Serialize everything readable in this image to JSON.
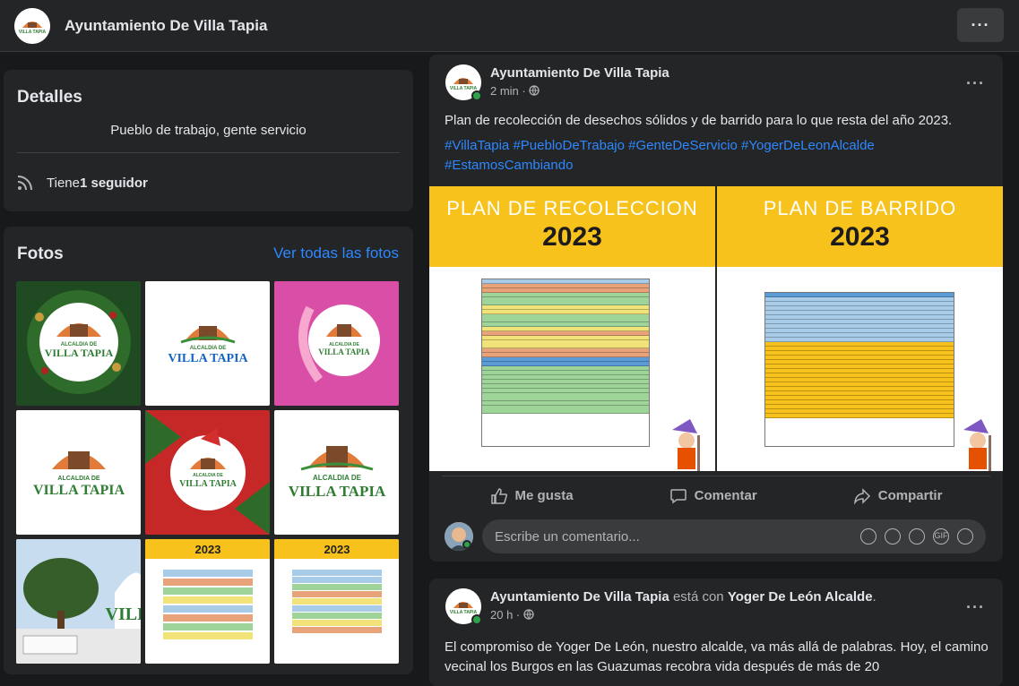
{
  "page": {
    "title": "Ayuntamiento De Villa Tapia",
    "more_label": "···"
  },
  "details": {
    "heading": "Detalles",
    "description": "Pueblo de trabajo, gente servicio",
    "followers_prefix": "Tiene ",
    "followers_count": "1 seguidor"
  },
  "photos": {
    "heading": "Fotos",
    "see_all": "Ver todas las fotos",
    "thumbs": [
      {
        "logo_small": "ALCALDIA DE",
        "logo_big": "VILLA TAPIA",
        "theme": "christmas-wreath"
      },
      {
        "logo_small": "ALCALDIA DE",
        "logo_big": "VILLA TAPIA",
        "theme": "white"
      },
      {
        "logo_small": "ALCALDIA DE",
        "logo_big": "VILLA TAPIA",
        "theme": "pink-ribbon"
      },
      {
        "logo_small": "ALCALDIA DE",
        "logo_big": "VILLA TAPIA",
        "theme": "white"
      },
      {
        "logo_small": "ALCALDIA DE",
        "logo_big": "VILLA TAPIA",
        "theme": "christmas-red"
      },
      {
        "logo_small": "ALCALDIA DE",
        "logo_big": "VILLA TAPIA",
        "theme": "white"
      },
      {
        "logo_small": "",
        "logo_big": "VILL",
        "theme": "photo"
      },
      {
        "year": "2023",
        "theme": "plan-recoleccion"
      },
      {
        "year": "2023",
        "theme": "plan-barrido"
      }
    ]
  },
  "post1": {
    "author": "Ayuntamiento De Villa Tapia",
    "time": "2 min · ",
    "text": "Plan de recolección de desechos sólidos y de barrido para lo que resta del año 2023.",
    "hashtags": "#VillaTapia #PuebloDeTrabajo #GenteDeServicio #YogerDeLeonAlcalde #EstamosCambiando",
    "banner_left_title": "PLAN DE RECOLECCION",
    "banner_left_year": "2023",
    "banner_right_title": "PLAN DE BARRIDO",
    "banner_right_year": "2023",
    "like_label": "Me gusta",
    "comment_label": "Comentar",
    "share_label": "Compartir",
    "comment_placeholder": "Escribe un comentario...",
    "gif_label": "GIF"
  },
  "post2": {
    "author": "Ayuntamiento De Villa Tapia",
    "with_text": " está con ",
    "tagged": "Yoger De León Alcalde",
    "tail": ".",
    "time": "20 h · ",
    "text": "El compromiso de Yoger De León, nuestro alcalde, va más allá de palabras. Hoy, el camino vecinal los Burgos en las Guazumas recobra vida después de más de 20"
  },
  "colors": {
    "background": "#18191a",
    "card": "#242526",
    "accent_link": "#2d88ff",
    "banner_yellow": "#f7c21b",
    "online": "#31a24c"
  }
}
